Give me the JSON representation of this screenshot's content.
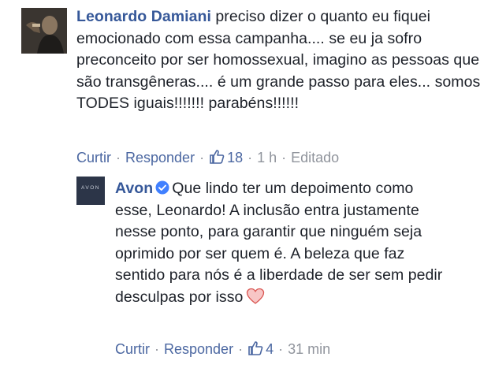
{
  "main_comment": {
    "author": "Leonardo Damiani",
    "text": "preciso dizer o quanto eu fiquei emocionado com essa campanha.... se eu ja sofro preconceito por ser homossexual, imagino as pessoas que são transgêneras.... é um grande passo para eles... somos TODES iguais!!!!!!! parabéns!!!!!!",
    "actions": {
      "like_label": "Curtir",
      "reply_label": "Responder",
      "like_count": "18",
      "time": "1 h",
      "edited": "Editado"
    }
  },
  "reply_comment": {
    "author": "Avon",
    "verified": true,
    "text": "Que lindo ter um depoimento como esse, Leonardo! A inclusão entra justamente nesse ponto, para garantir que ninguém seja oprimido por ser quem é. A beleza que faz sentido para nós é a liberdade de ser sem pedir desculpas por isso",
    "avatar_text": "AVON",
    "actions": {
      "like_label": "Curtir",
      "reply_label": "Responder",
      "like_count": "4",
      "time": "31 min"
    }
  },
  "icons": {
    "like": "thumbs-up-icon",
    "verified": "verified-badge-icon",
    "heart": "heart-emoji-icon"
  },
  "colors": {
    "link": "#365899",
    "meta": "#90949c",
    "text": "#1d2129",
    "verified": "#4080ff",
    "heart": "#f4a6a6"
  }
}
